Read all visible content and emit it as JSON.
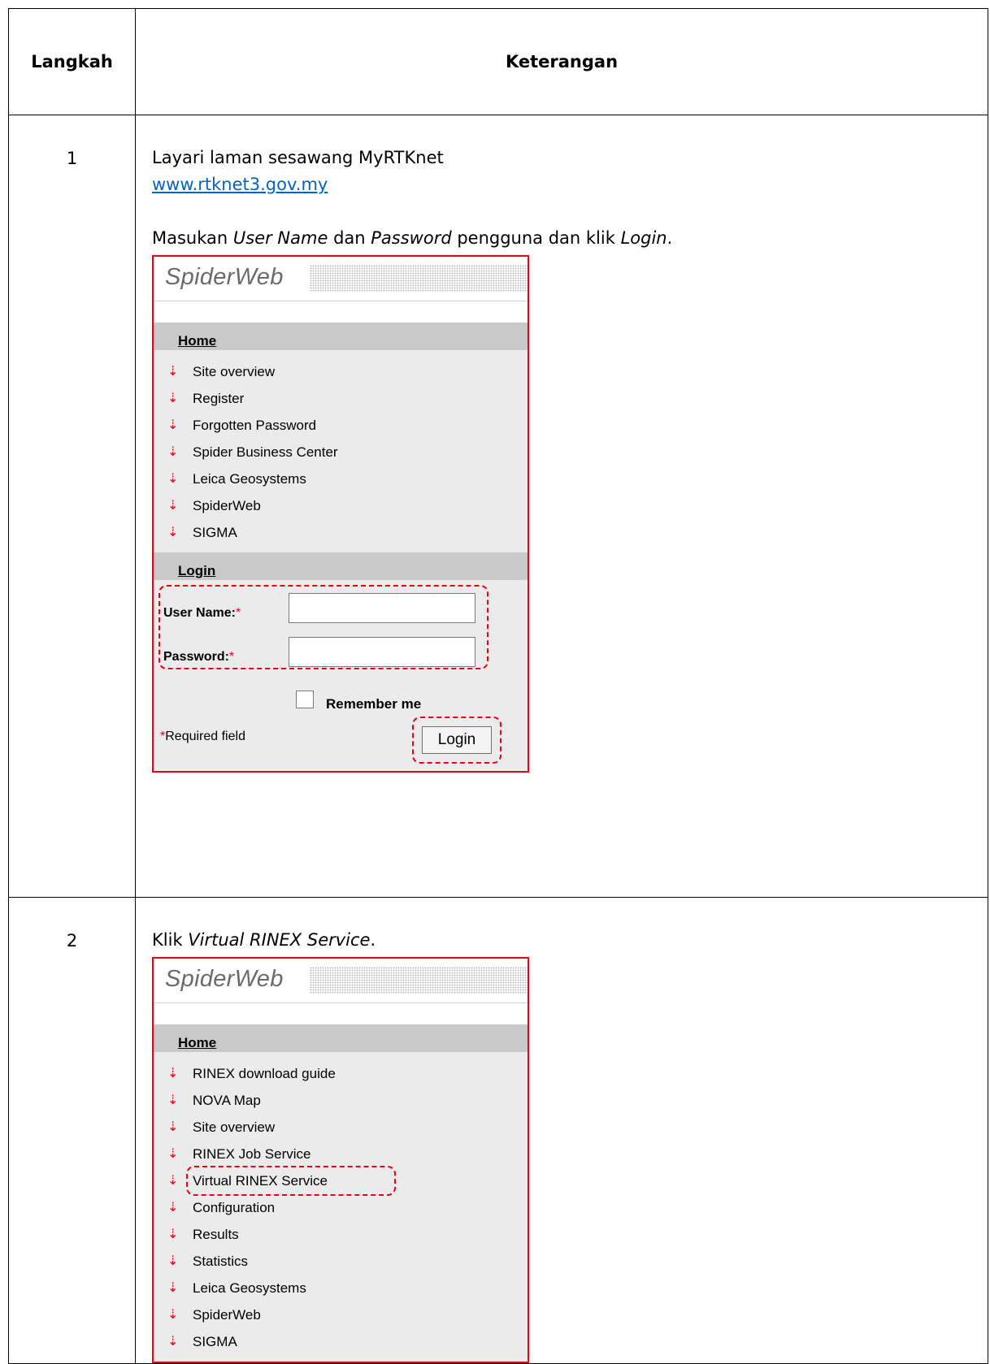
{
  "table": {
    "header_step": "Langkah",
    "header_desc": "Keterangan"
  },
  "step1": {
    "number": "1",
    "line1": "Layari laman sesawang MyRTKnet",
    "link": "www.rtknet3.gov.my",
    "instr_prefix": "Masukan ",
    "instr_user": "User Name",
    "instr_mid": " dan ",
    "instr_pass": "Password",
    "instr_mid2": " pengguna dan klik ",
    "instr_login": "Login",
    "instr_end": "."
  },
  "step2": {
    "number": "2",
    "instr_prefix": "Klik ",
    "instr_em": "Virtual RINEX Service",
    "instr_end": "."
  },
  "panel1": {
    "logo": "SpiderWeb",
    "home_heading": "Home",
    "items": [
      "Site overview",
      "Register",
      "Forgotten Password",
      "Spider Business Center",
      "Leica Geosystems",
      "SpiderWeb",
      "SIGMA"
    ],
    "login_heading": "Login",
    "user_label": "User Name:",
    "password_label": "Password:",
    "required_mark": "*",
    "user_value": "",
    "password_value": "",
    "remember_label": "Remember me",
    "required_note": "Required field",
    "login_button": "Login"
  },
  "panel2": {
    "logo": "SpiderWeb",
    "home_heading": "Home",
    "items": [
      "RINEX download guide",
      "NOVA Map",
      "Site overview",
      "RINEX Job Service",
      "Virtual RINEX Service",
      "Configuration",
      "Results",
      "Statistics",
      "Leica Geosystems",
      "SpiderWeb",
      "SIGMA"
    ]
  },
  "colors": {
    "highlight": "#e60012",
    "link": "#0563c1",
    "panel_bg": "#ebebeb",
    "section_bg": "#c9c9c9"
  },
  "icons": {
    "menu_item": "red-down-arrow-icon"
  }
}
